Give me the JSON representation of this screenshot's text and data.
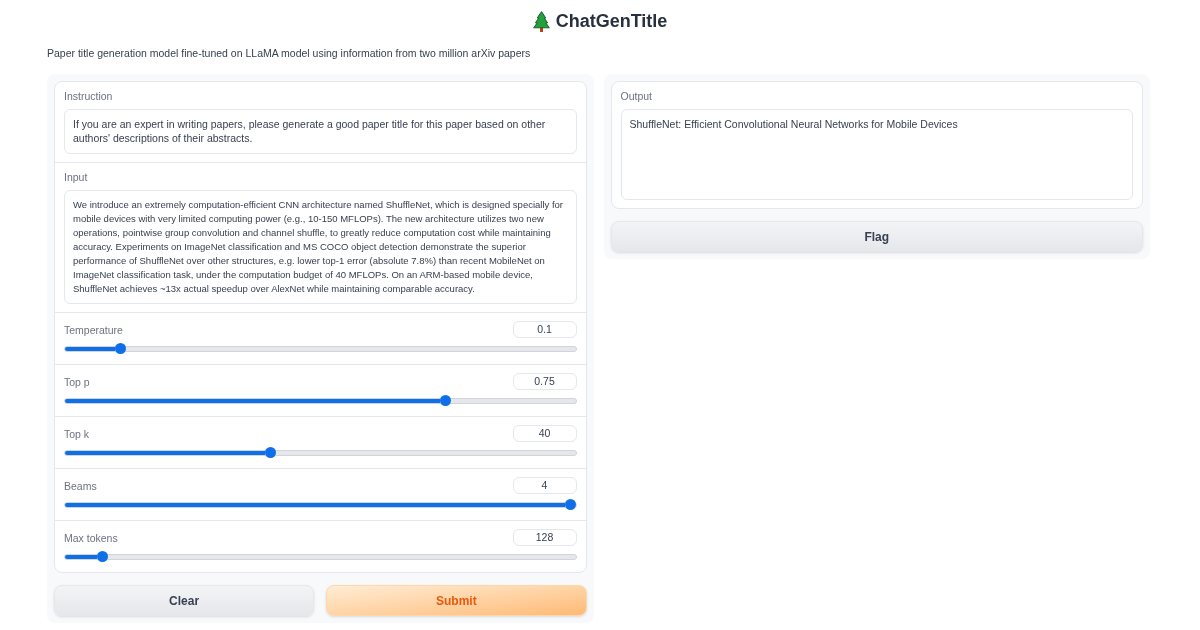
{
  "header": {
    "title": "ChatGenTitle",
    "description": "Paper title generation model fine-tuned on LLaMA model using information from two million arXiv papers"
  },
  "text_fields": [
    {
      "label": "Instruction",
      "value": "If you are an expert in writing papers, please generate a good paper title for this paper based on other authors' descriptions of their abstracts."
    },
    {
      "label": "Input",
      "value": "We introduce an extremely computation-efficient CNN architecture named ShuffleNet, which is designed specially for mobile devices with very limited computing power (e.g., 10-150 MFLOPs). The new architecture utilizes two new operations, pointwise group convolution and channel shuffle, to greatly reduce computation cost while maintaining accuracy. Experiments on ImageNet classification and MS COCO object detection demonstrate the superior performance of ShuffleNet over other structures, e.g. lower top-1 error (absolute 7.8%) than recent MobileNet on ImageNet classification task, under the computation budget of 40 MFLOPs. On an ARM-based mobile device, ShuffleNet achieves ~13x actual speedup over AlexNet while maintaining comparable accuracy."
    }
  ],
  "sliders": [
    {
      "label": "Temperature",
      "reading": "0.1",
      "level": 0.1
    },
    {
      "label": "Top p",
      "reading": "0.75",
      "level": 0.75
    },
    {
      "label": "Top k",
      "reading": "40",
      "level": 0.4
    },
    {
      "label": "Beams",
      "reading": "4",
      "level": 1
    },
    {
      "label": "Max tokens",
      "reading": "128",
      "level": 0.064
    }
  ],
  "buttons": [
    {
      "label": "Clear",
      "kind": "secondary"
    },
    {
      "label": "Submit",
      "kind": "primary"
    }
  ],
  "output": {
    "label": "Output",
    "value": "ShuffleNet: Efficient Convolutional Neural Networks for Mobile Devices"
  },
  "flag_button": {
    "label": "Flag",
    "kind": "secondary"
  }
}
